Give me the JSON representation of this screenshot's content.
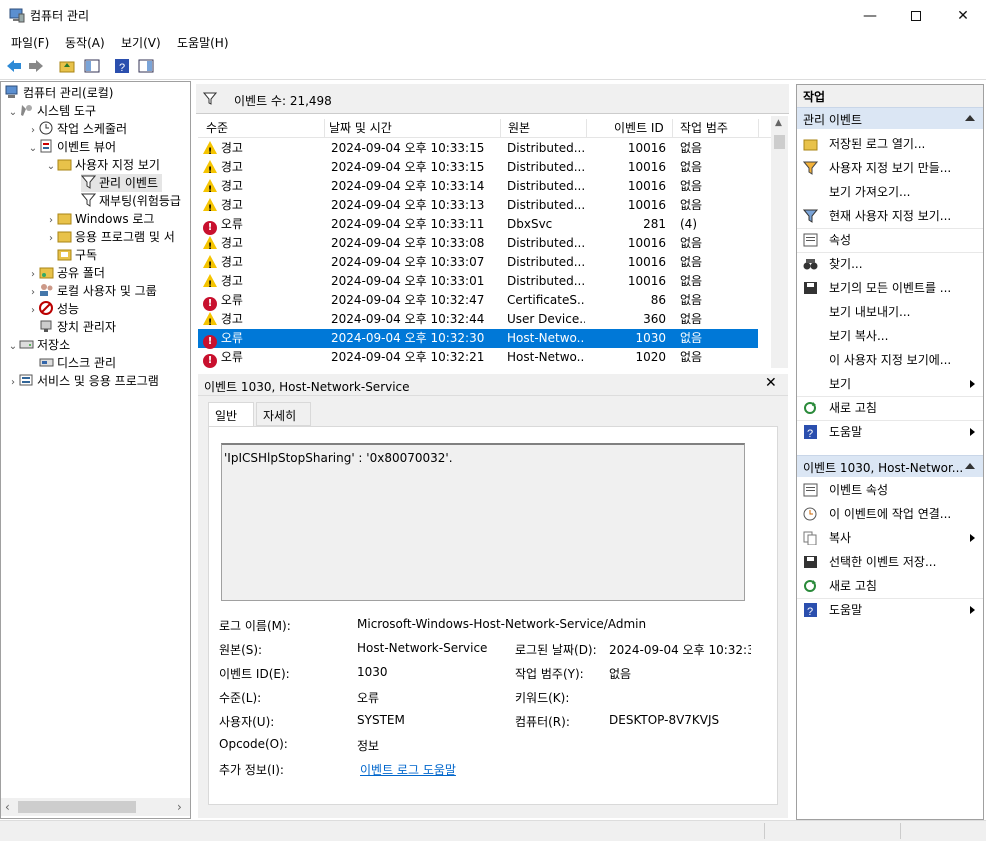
{
  "window": {
    "title": "컴퓨터 관리"
  },
  "menu": [
    "파일(F)",
    "동작(A)",
    "보기(V)",
    "도움말(H)"
  ],
  "tree": {
    "root": "컴퓨터 관리(로컬)",
    "system_tools": "시스템 도구",
    "task_scheduler": "작업 스케줄러",
    "event_viewer": "이벤트 뷰어",
    "custom_views": "사용자 지정 보기",
    "admin_events": "관리 이벤트",
    "reboot": "재부팅(위험등급",
    "windows_logs": "Windows 로그",
    "app_service_logs": "응용 프로그램 및 서",
    "subscriptions": "구독",
    "shared_folders": "공유 폴더",
    "local_users": "로컬 사용자 및 그룹",
    "performance": "성능",
    "device_manager": "장치 관리자",
    "storage": "저장소",
    "disk_management": "디스크 관리",
    "services_apps": "서비스 및 응용 프로그램"
  },
  "filter": {
    "label": "이벤트 수: 21,498"
  },
  "grid": {
    "columns": [
      "수준",
      "날짜 및 시간",
      "원본",
      "이벤트 ID",
      "작업 범주"
    ],
    "rows": [
      {
        "level": "경고",
        "icon": "warning",
        "datetime": "2024-09-04 오후 10:33:15",
        "source": "Distributed...",
        "id": "10016",
        "category": "없음"
      },
      {
        "level": "경고",
        "icon": "warning",
        "datetime": "2024-09-04 오후 10:33:15",
        "source": "Distributed...",
        "id": "10016",
        "category": "없음"
      },
      {
        "level": "경고",
        "icon": "warning",
        "datetime": "2024-09-04 오후 10:33:14",
        "source": "Distributed...",
        "id": "10016",
        "category": "없음"
      },
      {
        "level": "경고",
        "icon": "warning",
        "datetime": "2024-09-04 오후 10:33:13",
        "source": "Distributed...",
        "id": "10016",
        "category": "없음"
      },
      {
        "level": "오류",
        "icon": "error",
        "datetime": "2024-09-04 오후 10:33:11",
        "source": "DbxSvc",
        "id": "281",
        "category": "(4)"
      },
      {
        "level": "경고",
        "icon": "warning",
        "datetime": "2024-09-04 오후 10:33:08",
        "source": "Distributed...",
        "id": "10016",
        "category": "없음"
      },
      {
        "level": "경고",
        "icon": "warning",
        "datetime": "2024-09-04 오후 10:33:07",
        "source": "Distributed...",
        "id": "10016",
        "category": "없음"
      },
      {
        "level": "경고",
        "icon": "warning",
        "datetime": "2024-09-04 오후 10:33:01",
        "source": "Distributed...",
        "id": "10016",
        "category": "없음"
      },
      {
        "level": "오류",
        "icon": "error",
        "datetime": "2024-09-04 오후 10:32:47",
        "source": "CertificateS...",
        "id": "86",
        "category": "없음"
      },
      {
        "level": "경고",
        "icon": "warning",
        "datetime": "2024-09-04 오후 10:32:44",
        "source": "User Device...",
        "id": "360",
        "category": "없음"
      },
      {
        "level": "오류",
        "icon": "error",
        "datetime": "2024-09-04 오후 10:32:30",
        "source": "Host-Netwo...",
        "id": "1030",
        "category": "없음",
        "selected": true
      },
      {
        "level": "오류",
        "icon": "error",
        "datetime": "2024-09-04 오후 10:32:21",
        "source": "Host-Netwo...",
        "id": "1020",
        "category": "없음"
      }
    ]
  },
  "detail": {
    "header": "이벤트 1030, Host-Network-Service",
    "tabs": [
      "일반",
      "자세히"
    ],
    "description": "'IpICSHlpStopSharing' : '0x80070032'.",
    "log_name_label": "로그 이름(M):",
    "log_name": "Microsoft-Windows-Host-Network-Service/Admin",
    "source_label": "원본(S):",
    "source": "Host-Network-Service",
    "logged_label": "로그된 날짜(D):",
    "logged": "2024-09-04 오후 10:32:3(",
    "event_id_label": "이벤트 ID(E):",
    "event_id": "1030",
    "task_cat_label": "작업 범주(Y):",
    "task_cat": "없음",
    "level_label": "수준(L):",
    "level": "오류",
    "keywords_label": "키워드(K):",
    "user_label": "사용자(U):",
    "user": "SYSTEM",
    "computer_label": "컴퓨터(R):",
    "computer": "DESKTOP-8V7KVJS",
    "opcode_label": "Opcode(O):",
    "opcode": "정보",
    "more_info_label": "추가 정보(I):",
    "more_info_link": "이벤트 로그 도움말"
  },
  "actions": {
    "header": "작업",
    "section1": "관리 이벤트",
    "items1": [
      "저장된 로그 열기...",
      "사용자 지정 보기 만들...",
      "보기 가져오기...",
      "현재 사용자 지정 보기...",
      "속성",
      "찾기...",
      "보기의 모든 이벤트를 ...",
      "보기 내보내기...",
      "보기 복사...",
      "이 사용자 지정 보기에...",
      "보기",
      "새로 고침",
      "도움말"
    ],
    "section2": "이벤트 1030, Host-Networ...",
    "items2": [
      "이벤트 속성",
      "이 이벤트에 작업 연결...",
      "복사",
      "선택한 이벤트 저장...",
      "새로 고침",
      "도움말"
    ]
  }
}
